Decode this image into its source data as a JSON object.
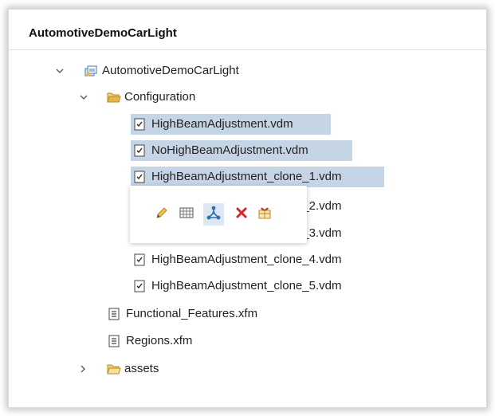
{
  "panel": {
    "title": "AutomotiveDemoCarLight"
  },
  "tree": {
    "project": {
      "label": "AutomotiveDemoCarLight"
    },
    "configuration": {
      "label": "Configuration"
    },
    "files": [
      {
        "label": "HighBeamAdjustment.vdm"
      },
      {
        "label": "NoHighBeamAdjustment.vdm"
      },
      {
        "label": "HighBeamAdjustment_clone_1.vdm"
      },
      {
        "label": "HighBeamAdjustment_clone_2.vdm"
      },
      {
        "label": "HighBeamAdjustment_clone_3.vdm"
      },
      {
        "label": "HighBeamAdjustment_clone_4.vdm"
      },
      {
        "label": "HighBeamAdjustment_clone_5.vdm"
      }
    ],
    "functional_features": {
      "label": "Functional_Features.xfm"
    },
    "regions": {
      "label": "Regions.xfm"
    },
    "assets": {
      "label": "assets"
    }
  },
  "popup_toolbar": {
    "actions": [
      {
        "icon": "pencil-icon"
      },
      {
        "icon": "table-icon"
      },
      {
        "icon": "graph-icon"
      },
      {
        "icon": "delete-icon"
      },
      {
        "icon": "package-icon"
      }
    ]
  },
  "colors": {
    "selection": "#c5d5e6",
    "accent_blue": "#2f6db5",
    "folder": "#e8b44a",
    "delete": "#d9232d"
  }
}
